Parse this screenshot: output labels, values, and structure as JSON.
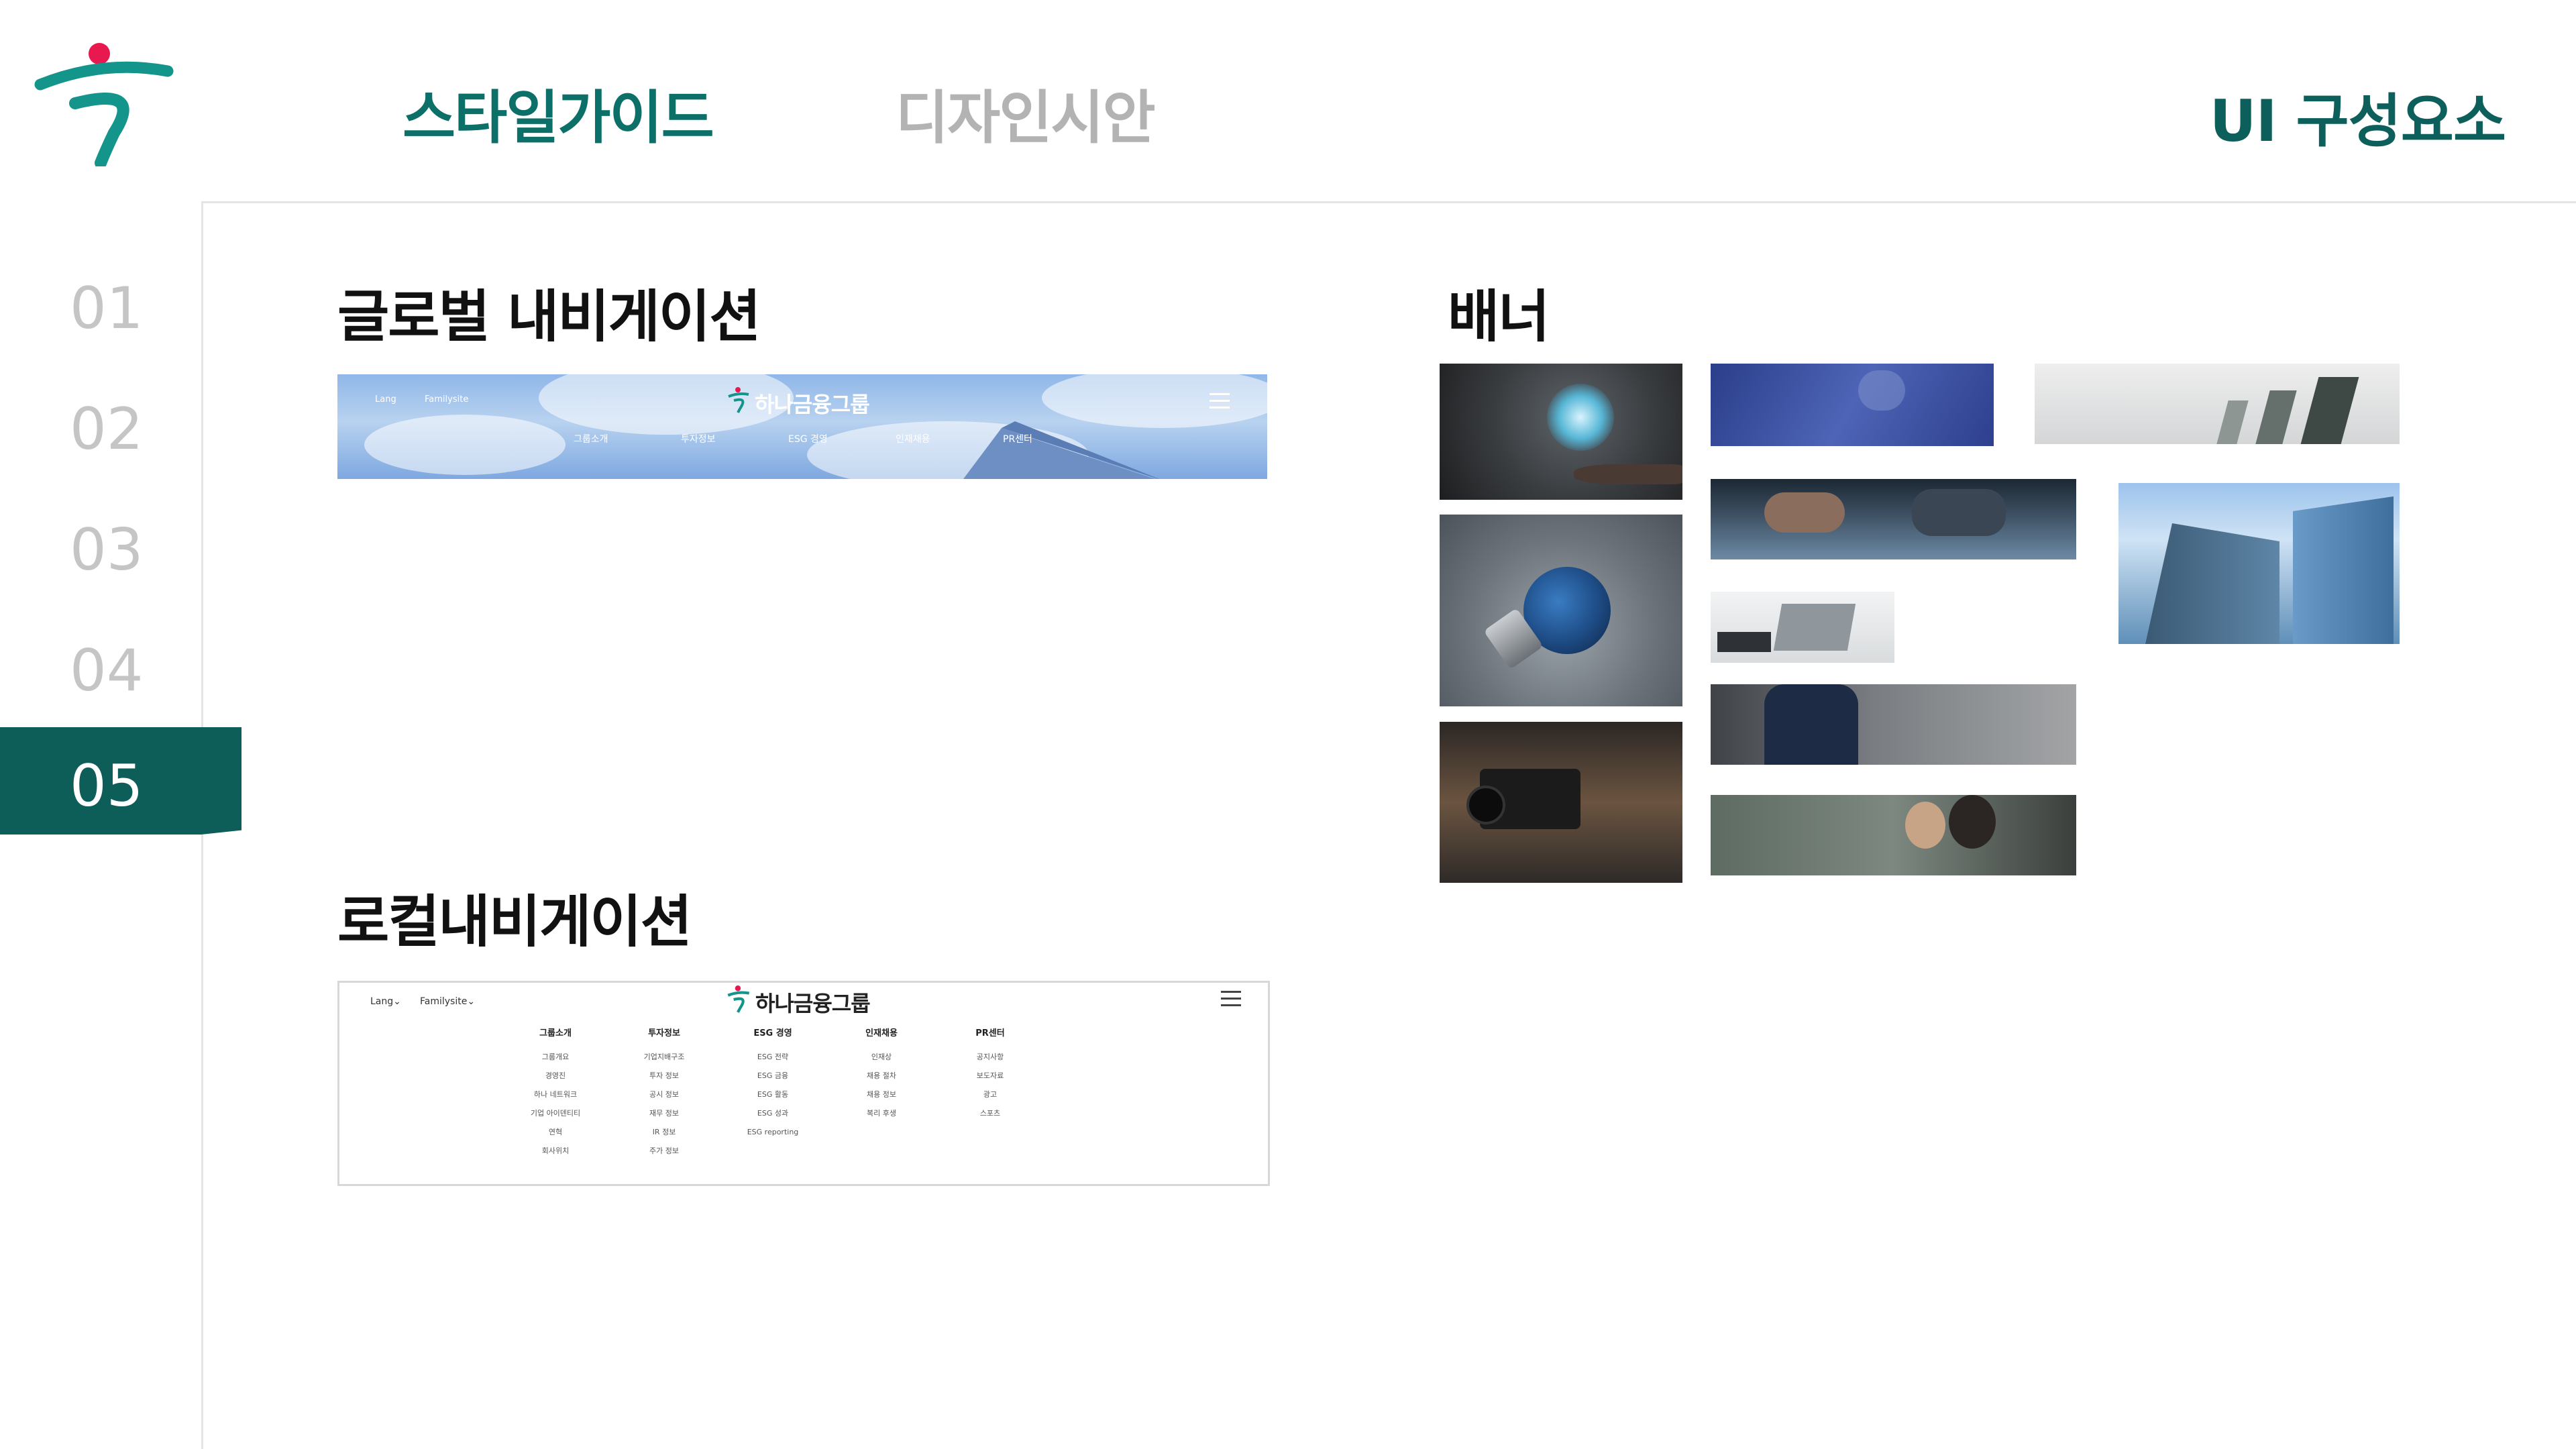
{
  "header": {
    "nav": [
      "스타일가이드",
      "디자인시안"
    ],
    "page_heading": "UI 구성요소"
  },
  "side_numbers": [
    "01",
    "02",
    "03",
    "04",
    "05"
  ],
  "active_index": 4,
  "sections": {
    "global_nav": "글로벌 내비게이션",
    "local_nav": "로컬내비게이션",
    "banner": "배너"
  },
  "gnb_preview": {
    "lang": "Lang",
    "family": "Familysite",
    "brand": "하나금융그룹",
    "menu": [
      "그룹소개",
      "투자정보",
      "ESG 경영",
      "인재채용",
      "PR센터"
    ]
  },
  "lnb_preview": {
    "lang": "Lang⌄",
    "family": "Familysite⌄",
    "brand": "하나금융그룹",
    "columns": [
      {
        "head": "그룹소개",
        "items": [
          "그룹개요",
          "경영진",
          "하나 네트워크",
          "기업 아이덴티티",
          "연혁",
          "회사위치"
        ]
      },
      {
        "head": "투자정보",
        "items": [
          "기업지배구조",
          "투자 정보",
          "공시 정보",
          "재무 정보",
          "IR 정보",
          "주가 정보"
        ]
      },
      {
        "head": "ESG 경영",
        "items": [
          "ESG 전략",
          "ESG 금융",
          "ESG 활동",
          "ESG 성과",
          "ESG reporting"
        ]
      },
      {
        "head": "인재채용",
        "items": [
          "인재상",
          "채용 절차",
          "채용 정보",
          "복리 후생"
        ]
      },
      {
        "head": "PR센터",
        "items": [
          "공지사항",
          "보도자료",
          "광고",
          "스포츠"
        ]
      }
    ]
  },
  "colors": {
    "brand_green": "#0c6f68",
    "active_side": "#0d5e59",
    "logo_red": "#e8194f",
    "inactive": "#b3b3b3"
  }
}
